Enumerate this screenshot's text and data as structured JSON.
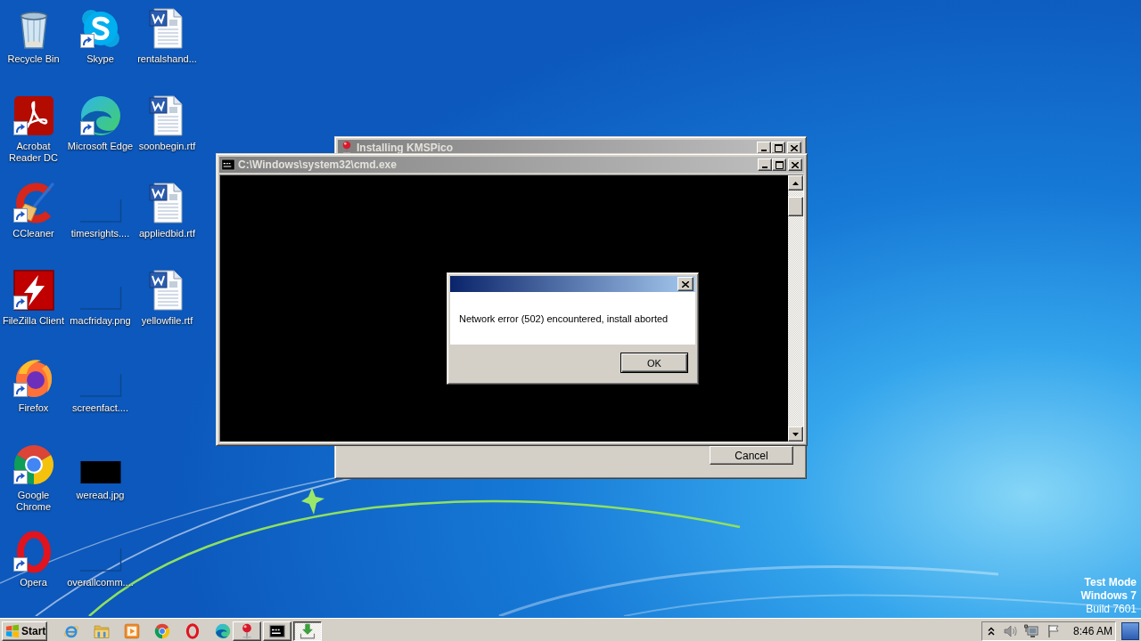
{
  "desktop": {
    "icons": [
      {
        "label": "Recycle Bin",
        "kind": "recycle-bin",
        "shortcut": false
      },
      {
        "label": "Acrobat Reader DC",
        "kind": "acrobat",
        "shortcut": true
      },
      {
        "label": "CCleaner",
        "kind": "ccleaner",
        "shortcut": true
      },
      {
        "label": "FileZilla Client",
        "kind": "filezilla",
        "shortcut": true
      },
      {
        "label": "Firefox",
        "kind": "firefox",
        "shortcut": true
      },
      {
        "label": "Google Chrome",
        "kind": "chrome",
        "shortcut": true
      },
      {
        "label": "Opera",
        "kind": "opera",
        "shortcut": true
      },
      {
        "label": "Skype",
        "kind": "skype",
        "shortcut": true
      },
      {
        "label": "Microsoft Edge",
        "kind": "edge",
        "shortcut": true
      },
      {
        "label": "timesrights....",
        "kind": "blank-image",
        "shortcut": false
      },
      {
        "label": "macfriday.png",
        "kind": "blank-image",
        "shortcut": false
      },
      {
        "label": "screenfact....",
        "kind": "blank-image",
        "shortcut": false
      },
      {
        "label": "weread.jpg",
        "kind": "dark-image",
        "shortcut": false
      },
      {
        "label": "overallcomm....",
        "kind": "blank-image",
        "shortcut": false
      },
      {
        "label": "rentalshand...",
        "kind": "document",
        "shortcut": false
      },
      {
        "label": "soonbegin.rtf",
        "kind": "document",
        "shortcut": false
      },
      {
        "label": "appliedbid.rtf",
        "kind": "document",
        "shortcut": false
      },
      {
        "label": "yellowfile.rtf",
        "kind": "document",
        "shortcut": false
      }
    ]
  },
  "windows": [
    {
      "kind": "installer",
      "title": "Installing KMSPico",
      "active": false,
      "cancel": "Cancel"
    },
    {
      "kind": "console",
      "title": "C:\\Windows\\system32\\cmd.exe",
      "active": false
    }
  ],
  "dialog": {
    "active": true,
    "message": "Network error (502) encountered, install aborted",
    "ok": "OK"
  },
  "test_mode": {
    "title": "Test Mode",
    "edition": "Windows 7",
    "build": "Build 7601"
  },
  "taskbar": {
    "start": "Start",
    "quick_launch": [
      {
        "kind": "ie"
      },
      {
        "kind": "folder"
      },
      {
        "kind": "media-player"
      },
      {
        "kind": "chrome"
      },
      {
        "kind": "opera"
      },
      {
        "kind": "edge"
      }
    ],
    "tasks": [
      {
        "kind": "pushpin",
        "selected": false
      },
      {
        "kind": "console",
        "selected": false
      },
      {
        "kind": "download",
        "selected": true
      }
    ],
    "clock": "8:46 AM"
  }
}
